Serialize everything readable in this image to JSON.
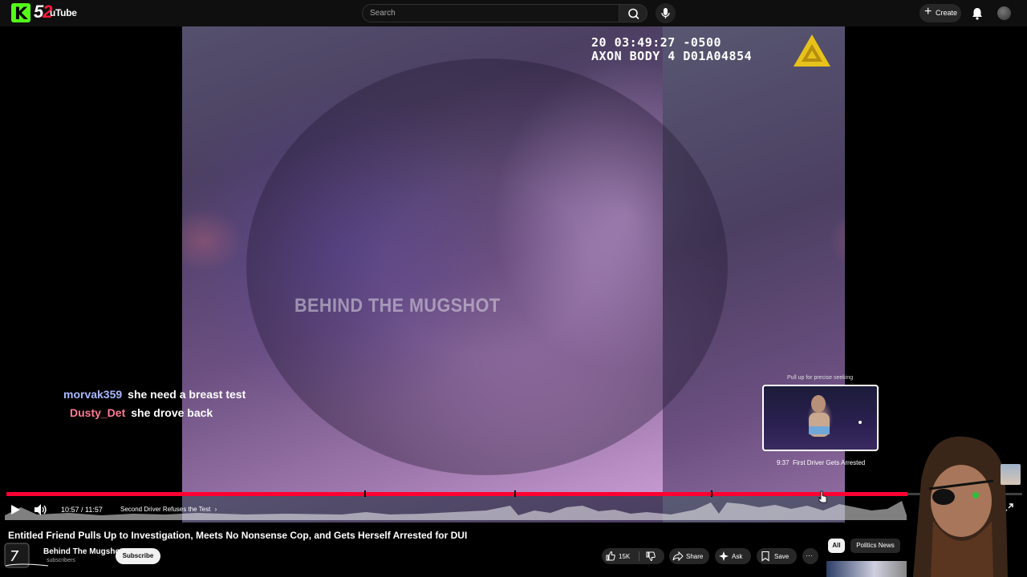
{
  "header": {
    "logo_k": "K",
    "logo_num_1": "5",
    "logo_num_2": "2",
    "logo_text": "uTube",
    "search_placeholder": "Search",
    "create_label": "Create"
  },
  "video": {
    "timestamp_line1": "20        03:49:27 -0500",
    "timestamp_line2": "AXON BODY 4 D01A04854",
    "watermark": "BEHIND THE MUGSHOT"
  },
  "chat": [
    {
      "user": "morvak359",
      "message": "she need a breast test",
      "color": "#a9b8ff"
    },
    {
      "user": "Dusty_Det",
      "message": "she drove back",
      "color": "#ff7a93"
    }
  ],
  "preview": {
    "hint": "Pull up for precise seeking",
    "time": "9:37",
    "chapter": "First Driver Gets Arrested"
  },
  "controls": {
    "time": "10:57 / 11:57",
    "chapter": "Second Driver Refuses the Test",
    "chapter_chevron": "›",
    "progress_fraction": 0.8868
  },
  "info": {
    "title": "Entitled Friend Pulls Up to Investigation, Meets No Nonsense Cop, and Gets Herself Arrested for DUI",
    "channel": "Behind The Mugshot",
    "subs": "subscribers",
    "subscribe": "Subscribe",
    "likes": "15K",
    "share": "Share",
    "ask": "Ask",
    "save": "Save",
    "more": "···"
  },
  "chips": {
    "all": "All",
    "politics": "Politics News"
  },
  "colors": {
    "accent": "#ff0033",
    "kick_green": "#53fc18"
  }
}
